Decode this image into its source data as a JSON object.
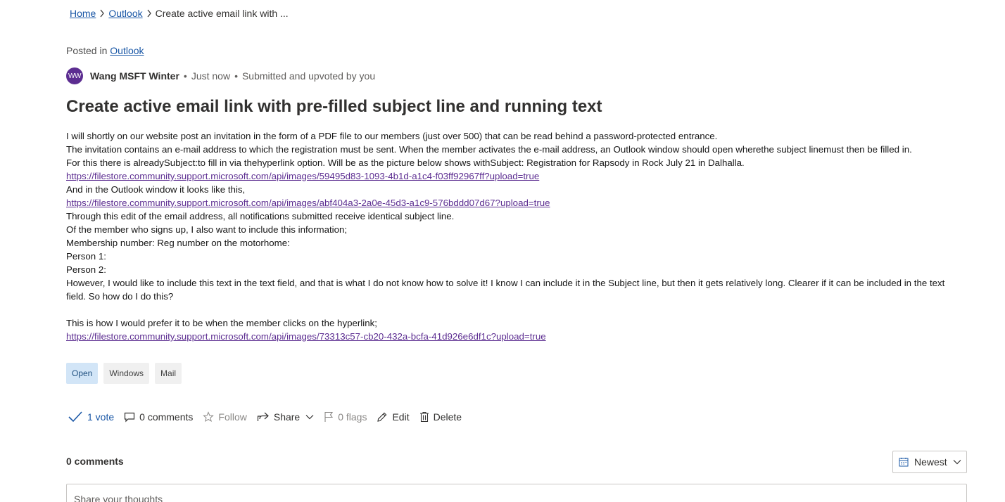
{
  "breadcrumb": {
    "home": "Home",
    "outlook": "Outlook",
    "current": "Create active email link with ..."
  },
  "post": {
    "posted_in_label": "Posted in",
    "posted_in_link": "Outlook",
    "author_initials": "WW",
    "author_name": "Wang MSFT Winter",
    "time": "Just now",
    "status": "Submitted and upvoted by you",
    "title": "Create active email link with pre-filled subject line and running text",
    "body_lines": [
      {
        "text": "I will shortly on our website post an invitation in the form of a PDF file to our members (just over 500) that can be read behind a password-protected entrance."
      },
      {
        "text": "The invitation contains an e-mail address to which the registration must be sent. When the member activates the e-mail address, an Outlook window should open wherethe subject linemust then be filled in."
      },
      {
        "text": "For this there is alreadySubject:to fill in via thehyperlink option. Will be as the picture below shows withSubject: Registration for Rapsody in Rock July 21 in Dalhalla."
      },
      {
        "link": "https://filestore.community.support.microsoft.com/api/images/59495d83-1093-4b1d-a1c4-f03ff92967ff?upload=true"
      },
      {
        "text": "And in the Outlook window it looks like this,"
      },
      {
        "link": "https://filestore.community.support.microsoft.com/api/images/abf404a3-2a0e-45d3-a1c9-576bddd07d67?upload=true"
      },
      {
        "text": "Through this edit of the email address, all notifications submitted receive identical subject line."
      },
      {
        "text": "Of the member who signs up, I also want to include this information;"
      },
      {
        "text": "Membership number: Reg number on the motorhome:"
      },
      {
        "text": "Person 1:"
      },
      {
        "text": "Person 2:"
      },
      {
        "text": "However, I would like to include this text in the text field, and that is what I do not know how to solve it! I know I can include it in the Subject line, but then it gets relatively long. Clearer if it can be included in the text field. So how do I do this?"
      },
      {
        "text": ""
      },
      {
        "text": "This is how I would prefer it to be when the member clicks on the hyperlink;"
      },
      {
        "link": "https://filestore.community.support.microsoft.com/api/images/73313c57-cb20-432a-bcfa-41d926e6df1c?upload=true"
      }
    ],
    "tags": [
      "Open",
      "Windows",
      "Mail"
    ]
  },
  "actions": {
    "vote": "1 vote",
    "comments": "0 comments",
    "follow": "Follow",
    "share": "Share",
    "flags": "0 flags",
    "edit": "Edit",
    "delete": "Delete"
  },
  "comments_section": {
    "heading": "0 comments",
    "sort_label": "Newest",
    "input_placeholder": "Share your thoughts"
  },
  "colors": {
    "link": "#1a57a6",
    "visited_link": "#5c2d91",
    "avatar_bg": "#5c2d91",
    "open_tag_bg": "#d2e5f7"
  }
}
